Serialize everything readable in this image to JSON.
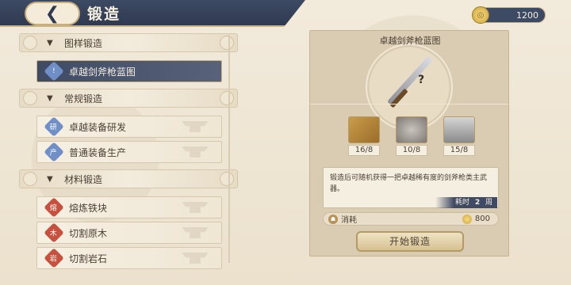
{
  "header": {
    "title": "锻造",
    "back_icon": "back-arrow-icon"
  },
  "currency": {
    "amount": "1200",
    "icon": "coin-icon",
    "icon_glyph": "◎"
  },
  "list": {
    "categories": [
      {
        "label": "图样锻造",
        "icon": "chevron-down-icon",
        "glyph": "▼"
      },
      {
        "label": "常规锻造",
        "icon": "chevron-down-icon",
        "glyph": "▼"
      },
      {
        "label": "材料锻造",
        "icon": "chevron-down-icon",
        "glyph": "▼"
      }
    ],
    "items": [
      {
        "label": "卓越剑斧枪蓝图",
        "icon": "blueprint-icon",
        "glyph": "!",
        "active": true
      },
      {
        "label": "卓越装备研发",
        "icon": "research-icon",
        "glyph": "研"
      },
      {
        "label": "普通装备生产",
        "icon": "production-icon",
        "glyph": "产"
      },
      {
        "label": "熔炼铁块",
        "icon": "smelting-icon",
        "glyph": "熔"
      },
      {
        "label": "切割原木",
        "icon": "woodcut-icon",
        "glyph": "木"
      },
      {
        "label": "切割岩石",
        "icon": "stonecut-icon",
        "glyph": "岩"
      }
    ]
  },
  "detail": {
    "name": "卓越剑斧枪蓝图",
    "unknown_mark": "?",
    "materials": [
      {
        "name": "gold-bars",
        "count": "16/8"
      },
      {
        "name": "ore",
        "count": "10/8"
      },
      {
        "name": "steel-bar",
        "count": "15/8"
      }
    ],
    "description": "锻造后可随机获得一把卓越稀有度的剑斧枪类主武器。",
    "time_label": "耗时",
    "time_value": "2",
    "time_unit": "周",
    "cost_label": "消耗",
    "cost_value": "800",
    "start_label": "开始锻造"
  },
  "colors": {
    "header": "#3d4a63",
    "accent": "#c9b486",
    "active_item": "#3f4b64"
  }
}
